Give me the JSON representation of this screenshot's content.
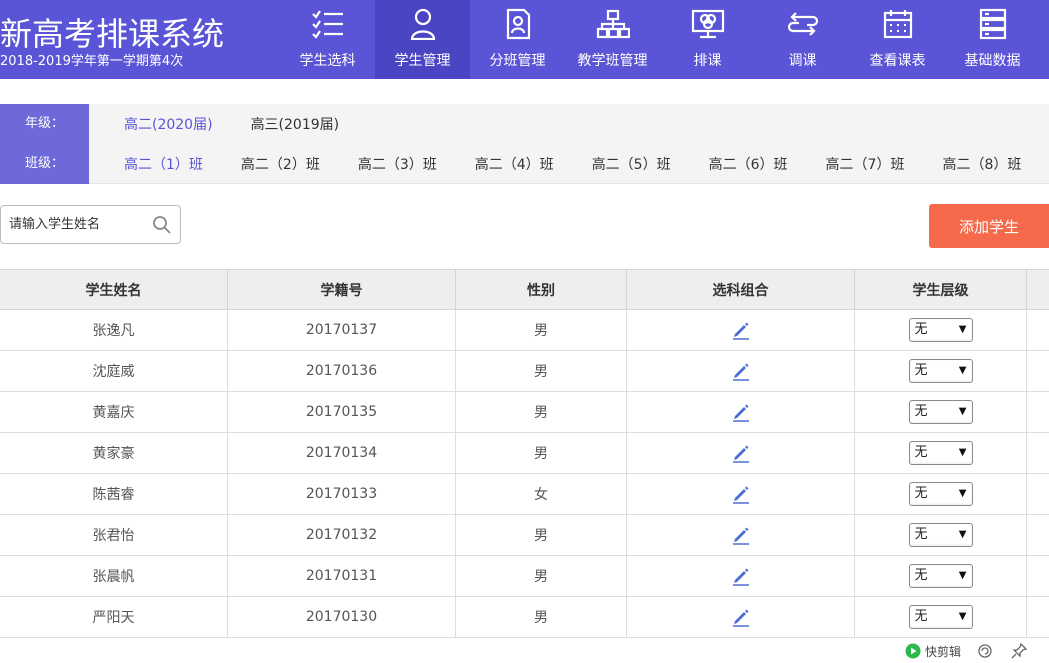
{
  "app": {
    "title": "新高考排课系统",
    "term": "2018-2019学年第一学期第4次"
  },
  "nav": [
    {
      "label": "学生选科",
      "icon": "checklist-icon",
      "active": false
    },
    {
      "label": "学生管理",
      "icon": "user-icon",
      "active": true
    },
    {
      "label": "分班管理",
      "icon": "document-user-icon",
      "active": false
    },
    {
      "label": "教学班管理",
      "icon": "org-chart-icon",
      "active": false
    },
    {
      "label": "排课",
      "icon": "monitor-icon",
      "active": false
    },
    {
      "label": "调课",
      "icon": "swap-icon",
      "active": false
    },
    {
      "label": "查看课表",
      "icon": "calendar-icon",
      "active": false
    },
    {
      "label": "基础数据",
      "icon": "database-icon",
      "active": false
    }
  ],
  "filter": {
    "grade_label": "年级：",
    "class_label": "班级：",
    "grades": [
      "高二(2020届)",
      "高三(2019届)"
    ],
    "grade_selected": 0,
    "classes": [
      "高二（1）班",
      "高二（2）班",
      "高二（3）班",
      "高二（4）班",
      "高二（5）班",
      "高二（6）班",
      "高二（7）班",
      "高二（8）班"
    ],
    "class_selected": 0
  },
  "search": {
    "placeholder": "请输入学生姓名",
    "value": ""
  },
  "actions": {
    "add_student": "添加学生"
  },
  "table": {
    "headers": [
      "学生姓名",
      "学籍号",
      "性别",
      "选科组合",
      "学生层级"
    ],
    "rows": [
      {
        "name": "张逸凡",
        "id": "20170137",
        "gender": "男",
        "level": "无"
      },
      {
        "name": "沈庭威",
        "id": "20170136",
        "gender": "男",
        "level": "无"
      },
      {
        "name": "黄嘉庆",
        "id": "20170135",
        "gender": "男",
        "level": "无"
      },
      {
        "name": "黄家豪",
        "id": "20170134",
        "gender": "男",
        "level": "无"
      },
      {
        "name": "陈茜睿",
        "id": "20170133",
        "gender": "女",
        "level": "无"
      },
      {
        "name": "张君怡",
        "id": "20170132",
        "gender": "男",
        "level": "无"
      },
      {
        "name": "张晨帆",
        "id": "20170131",
        "gender": "男",
        "level": "无"
      },
      {
        "name": "严阳天",
        "id": "20170130",
        "gender": "男",
        "level": "无"
      }
    ]
  },
  "tray": {
    "clip_label": "快剪辑"
  },
  "colors": {
    "header_bg": "#5a55d6",
    "nav_active": "#4a45c2",
    "filter_side": "#6e69d8",
    "accent_text": "#5a55d6",
    "add_button": "#f46a4a",
    "edit_icon": "#4a6fd0"
  }
}
